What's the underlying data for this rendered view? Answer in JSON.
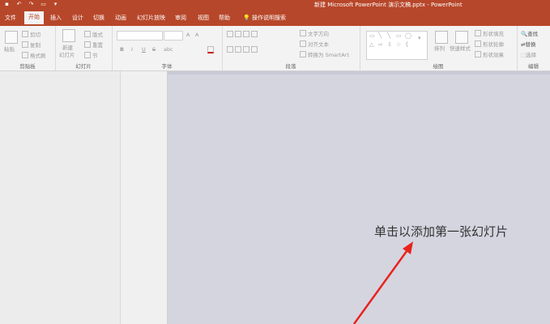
{
  "window": {
    "title": "新建 Microsoft PowerPoint 演示文稿.pptx - PowerPoint",
    "qat": [
      "save-icon",
      "undo-icon",
      "redo-icon",
      "present-icon",
      "customize-icon"
    ]
  },
  "tabs": [
    "文件",
    "开始",
    "插入",
    "设计",
    "切换",
    "动画",
    "幻灯片放映",
    "审阅",
    "视图",
    "帮助",
    "操作说明搜索"
  ],
  "active_tab": "开始",
  "ribbon": {
    "clipboard": {
      "label": "剪贴板",
      "paste": "粘贴",
      "cut": "剪切",
      "copy": "复制",
      "format_painter": "格式刷"
    },
    "slides": {
      "label": "幻灯片",
      "new_slide_line1": "新建",
      "new_slide_line2": "幻灯片",
      "layout": "版式",
      "reset": "重置",
      "section": "节"
    },
    "font": {
      "label": "字体",
      "bold": "B",
      "italic": "I",
      "underline": "U",
      "strike": "S",
      "spacing": "abc",
      "size_up": "A",
      "size_down": "A"
    },
    "paragraph": {
      "label": "段落",
      "text_direction": "文字方向",
      "align_text": "对齐文本",
      "smartart": "转换为 SmartArt"
    },
    "drawing": {
      "label": "绘图",
      "arrange": "排列",
      "quick_styles": "快速样式",
      "shape_fill": "形状填充",
      "shape_outline": "形状轮廓",
      "shape_effects": "形状效果"
    },
    "editing": {
      "label": "编辑",
      "find": "查找",
      "replace": "替换",
      "select": "选择"
    }
  },
  "slide": {
    "placeholder": "单击以添加第一张幻灯片"
  },
  "colors": {
    "accent": "#b7472a",
    "arrow": "#e8231e"
  }
}
